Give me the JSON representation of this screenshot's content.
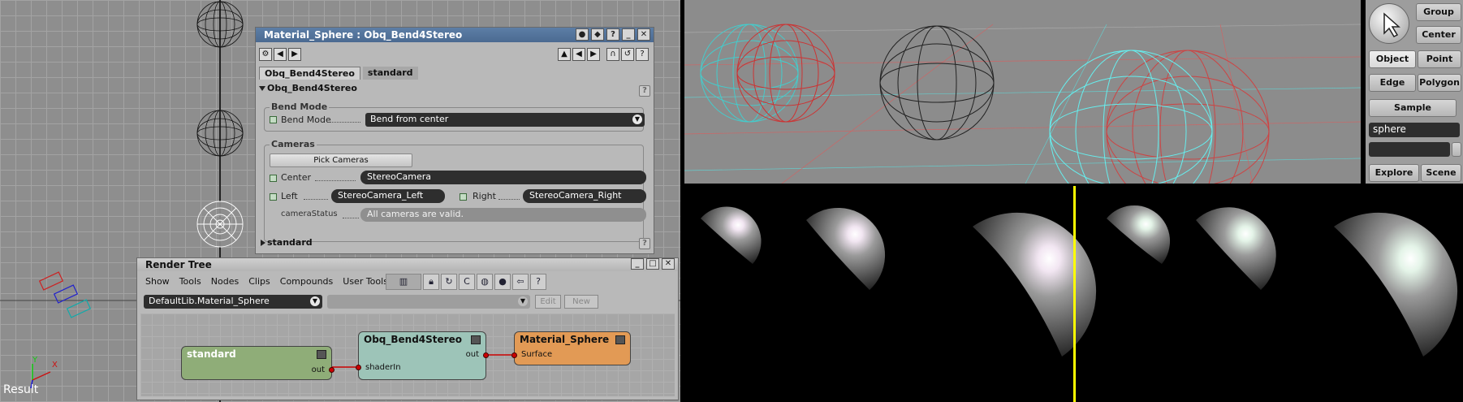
{
  "viewport_left": {
    "result_label": "Result"
  },
  "property_editor": {
    "title": "Material_Sphere : Obq_Bend4Stereo",
    "tabs": [
      "Obq_Bend4Stereo",
      "standard"
    ],
    "section_main": "Obq_Bend4Stereo",
    "bend_mode_group": "Bend Mode",
    "bend_mode_label": "Bend Mode",
    "bend_mode_value": "Bend from center",
    "cameras_group": "Cameras",
    "pick_cameras": "Pick Cameras",
    "center_label": "Center",
    "center_value": "StereoCamera",
    "left_label": "Left",
    "left_value": "StereoCamera_Left",
    "right_label": "Right",
    "right_value": "StereoCamera_Right",
    "status_label": "cameraStatus",
    "status_value": "All cameras are valid.",
    "section_standard": "standard"
  },
  "render_tree": {
    "title": "Render Tree",
    "menu": [
      "Show",
      "Tools",
      "Nodes",
      "Clips",
      "Compounds",
      "User Tools"
    ],
    "path": "DefaultLib.Material_Sphere",
    "edit_label": "Edit",
    "new_label": "New",
    "nodes": {
      "standard": {
        "title": "standard",
        "out": "out",
        "color": "#8fad78"
      },
      "bend": {
        "title": "Obq_Bend4Stereo",
        "in": "shaderIn",
        "out": "out",
        "color": "#9dc4b8"
      },
      "material": {
        "title": "Material_Sphere",
        "in": "Surface",
        "color": "#e29a55"
      }
    }
  },
  "side_panel": {
    "group": "Group",
    "center": "Center",
    "object": "Object",
    "point": "Point",
    "edge": "Edge",
    "polygon": "Polygon",
    "sample": "Sample",
    "search_value": "sphere",
    "explore": "Explore",
    "scene": "Scene"
  }
}
